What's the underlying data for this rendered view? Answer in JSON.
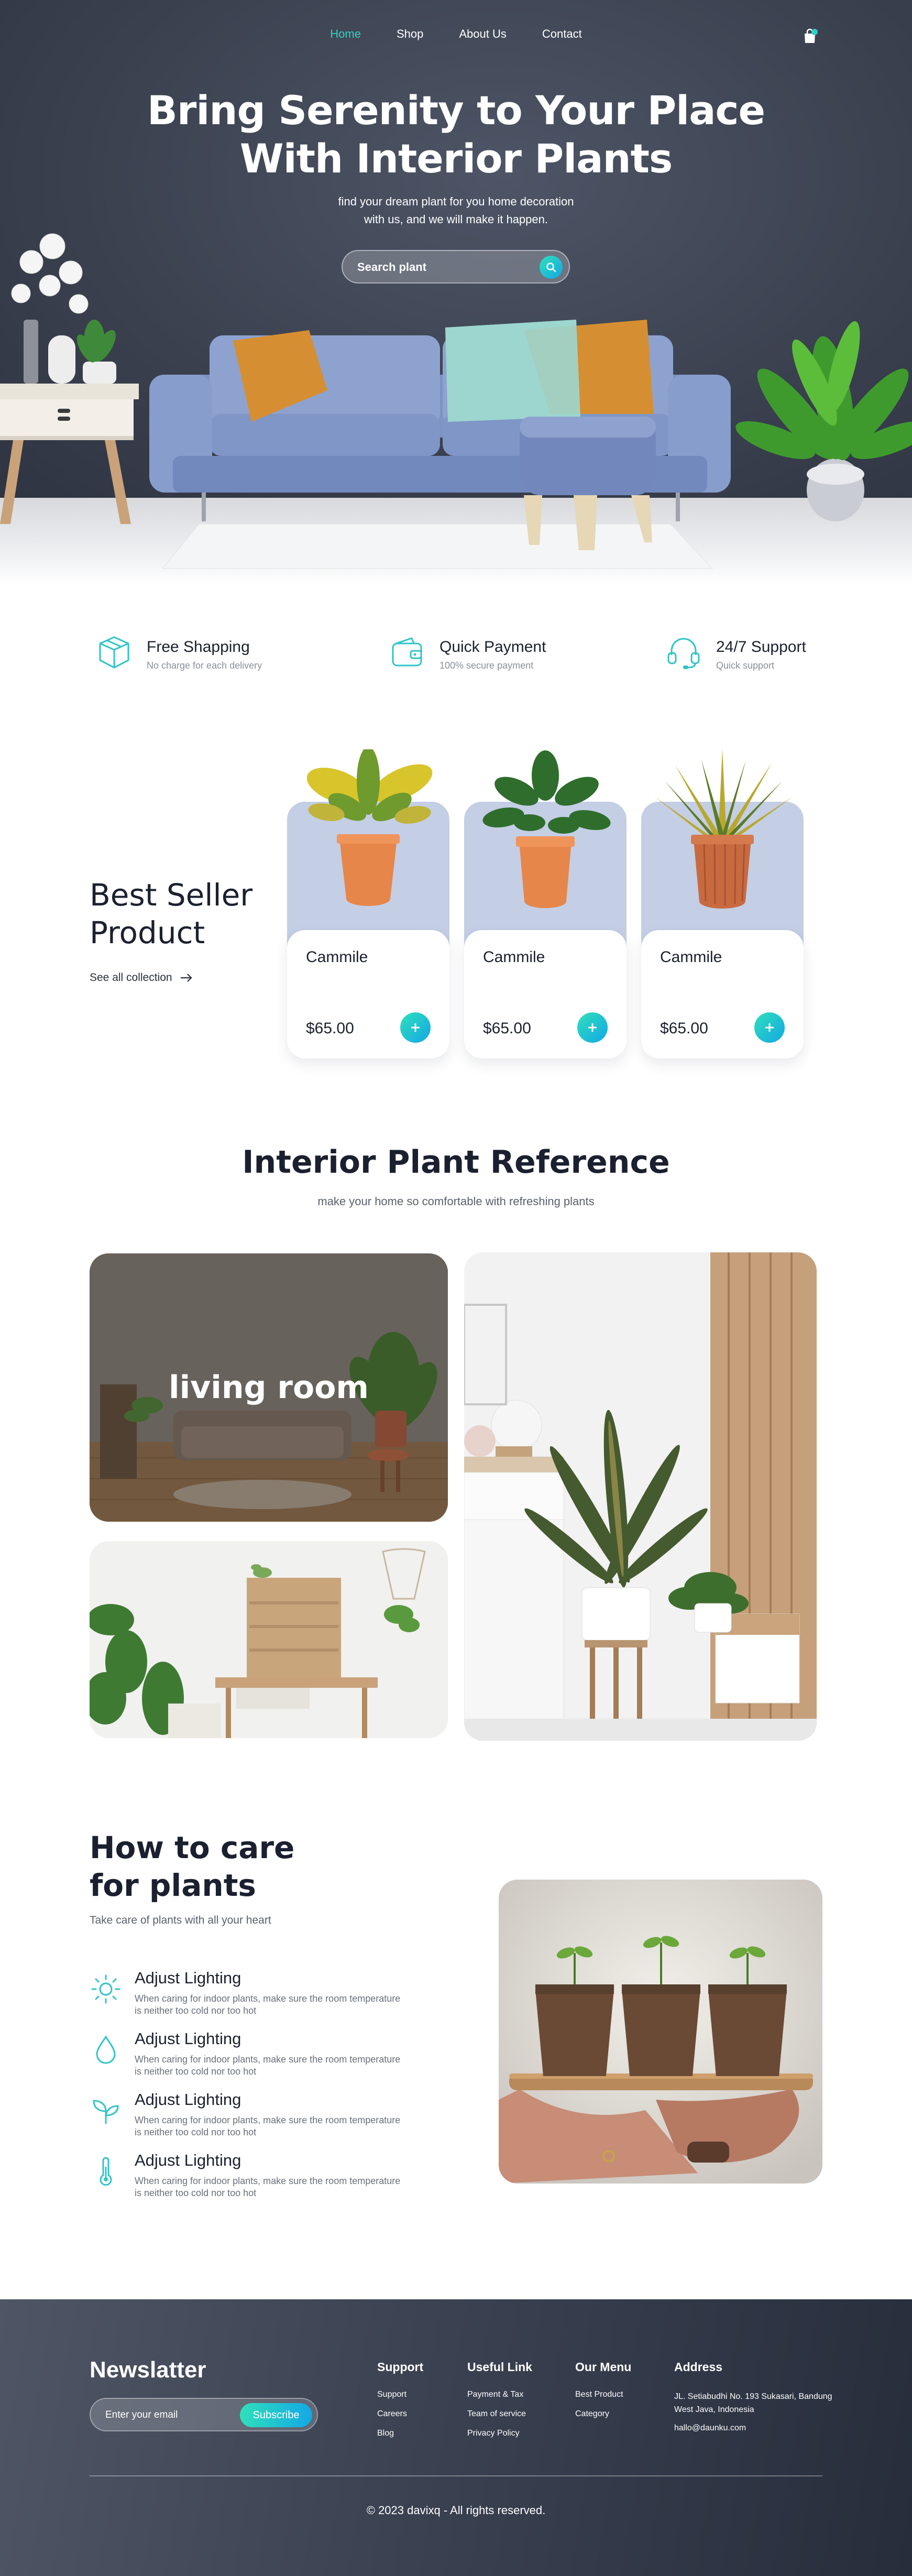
{
  "nav": {
    "items": [
      {
        "label": "Home",
        "active": true
      },
      {
        "label": "Shop",
        "active": false
      },
      {
        "label": "About Us",
        "active": false
      },
      {
        "label": "Contact",
        "active": false
      }
    ],
    "cart_icon": "shopping-bag-icon",
    "cart_badge_color": "#2fd1c2"
  },
  "hero": {
    "title_line1": "Bring Serenity to Your Place",
    "title_line2": "With Interior Plants",
    "subtitle_line1": "find your dream plant for you home decoration",
    "subtitle_line2": "with us, and we will make it happen.",
    "search_placeholder": "Search plant",
    "search_icon": "search-icon"
  },
  "features": [
    {
      "icon": "box-icon",
      "title": "Free Shapping",
      "subtitle": "No charge for each delivery"
    },
    {
      "icon": "wallet-icon",
      "title": "Quick Payment",
      "subtitle": "100% secure payment"
    },
    {
      "icon": "headset-icon",
      "title": "24/7 Support",
      "subtitle": "Quick support"
    }
  ],
  "best_seller": {
    "title_line1": "Best Seller",
    "title_line2": "Product",
    "link": "See all collection",
    "products": [
      {
        "name": "Cammile",
        "price": "$65.00"
      },
      {
        "name": "Cammile",
        "price": "$65.00"
      },
      {
        "name": "Cammile",
        "price": "$65.00"
      }
    ]
  },
  "reference": {
    "title": "Interior Plant Reference",
    "subtitle": "make your home so comfortable with refreshing plants",
    "tile_label": "living room"
  },
  "care": {
    "title_line1": "How to care",
    "title_line2": "for plants",
    "subtitle": "Take care of plants with all your heart",
    "tips": [
      {
        "icon": "sun-icon",
        "title": "Adjust Lighting",
        "desc": "When caring for indoor plants, make sure the room temperature is neither too cold nor too hot"
      },
      {
        "icon": "water-drop-icon",
        "title": "Adjust Lighting",
        "desc": "When caring for indoor plants, make sure the room temperature is neither too cold nor too hot"
      },
      {
        "icon": "sprout-icon",
        "title": "Adjust Lighting",
        "desc": "When caring for indoor plants, make sure the room temperature is neither too cold nor too hot"
      },
      {
        "icon": "thermometer-icon",
        "title": "Adjust Lighting",
        "desc": "When caring for indoor plants, make sure the room temperature is neither too cold nor too hot"
      }
    ]
  },
  "footer": {
    "newsletter_title": "Newslatter",
    "email_placeholder": "Enter your email",
    "subscribe_label": "Subscribe",
    "columns": [
      {
        "title": "Support",
        "links": [
          "Support",
          "Careers",
          "Blog"
        ]
      },
      {
        "title": "Useful Link",
        "links": [
          "Payment & Tax",
          "Team of service",
          "Privacy Policy"
        ]
      },
      {
        "title": "Our Menu",
        "links": [
          "Best Product",
          "Category"
        ]
      }
    ],
    "address_title": "Address",
    "address": "JL. Setiabudhi No. 193 Sukasari, Bandung West Java, Indonesia",
    "email": "hallo@daunku.com",
    "copyright": "© 2023 davixq - All rights reserved."
  },
  "colors": {
    "accent": "#2fd1c2",
    "accent_gradient_start": "#2fe0b9",
    "accent_gradient_end": "#13a7e6",
    "dark": "#1b2030",
    "card_bg": "#c4cee4"
  }
}
